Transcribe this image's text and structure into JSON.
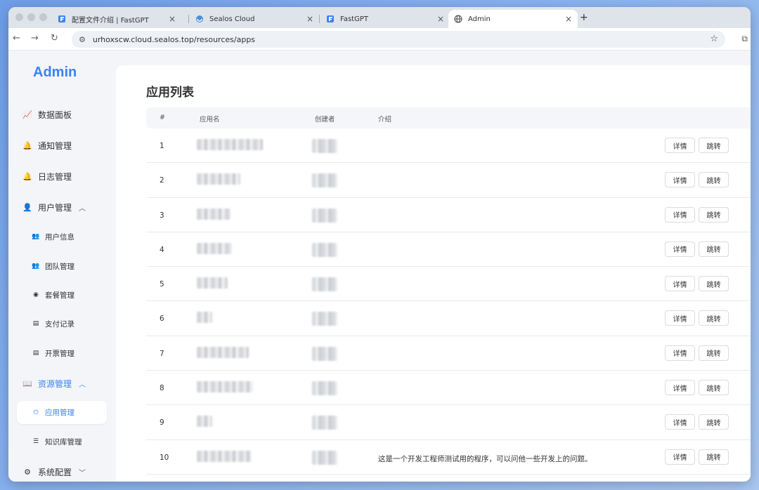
{
  "browser": {
    "tabs": [
      {
        "title": "配置文件介绍 | FastGPT",
        "icon": "fastgpt-icon"
      },
      {
        "title": "Sealos Cloud",
        "icon": "sealos-icon"
      },
      {
        "title": "FastGPT",
        "icon": "fastgpt-icon"
      },
      {
        "title": "Admin",
        "icon": "globe-icon"
      }
    ],
    "url": "urhoxscw.cloud.sealos.top/resources/apps",
    "close_glyph": "×",
    "new_tab_glyph": "+"
  },
  "sidebar": {
    "brand": "Admin",
    "items": [
      {
        "label": "数据面板",
        "icon": "chart-icon"
      },
      {
        "label": "通知管理",
        "icon": "bell-icon"
      },
      {
        "label": "日志管理",
        "icon": "bell-icon"
      },
      {
        "label": "用户管理",
        "icon": "user-icon"
      },
      {
        "label": "用户信息",
        "icon": "user-info-icon"
      },
      {
        "label": "团队管理",
        "icon": "team-icon"
      },
      {
        "label": "套餐管理",
        "icon": "package-icon"
      },
      {
        "label": "支付记录",
        "icon": "receipt-icon"
      },
      {
        "label": "开票管理",
        "icon": "invoice-icon"
      },
      {
        "label": "资源管理",
        "icon": "book-icon"
      },
      {
        "label": "应用管理",
        "icon": "app-icon"
      },
      {
        "label": "知识库管理",
        "icon": "database-icon"
      },
      {
        "label": "系统配置",
        "icon": "gear-icon"
      }
    ]
  },
  "main": {
    "title": "应用列表",
    "columns": [
      "#",
      "应用名",
      "创建者",
      "介绍"
    ],
    "detail_label": "详情",
    "jump_label": "跳转",
    "rows": [
      {
        "num": "1",
        "intro": ""
      },
      {
        "num": "2",
        "intro": ""
      },
      {
        "num": "3",
        "intro": ""
      },
      {
        "num": "4",
        "intro": ""
      },
      {
        "num": "5",
        "intro": ""
      },
      {
        "num": "6",
        "intro": ""
      },
      {
        "num": "7",
        "intro": ""
      },
      {
        "num": "8",
        "intro": ""
      },
      {
        "num": "9",
        "intro": ""
      },
      {
        "num": "10",
        "intro": "这是一个开发工程师测试用的程序，可以问他一些开发上的问题。"
      }
    ]
  },
  "colors": {
    "accent": "#3b82f6",
    "background": "#f3f5f9"
  }
}
